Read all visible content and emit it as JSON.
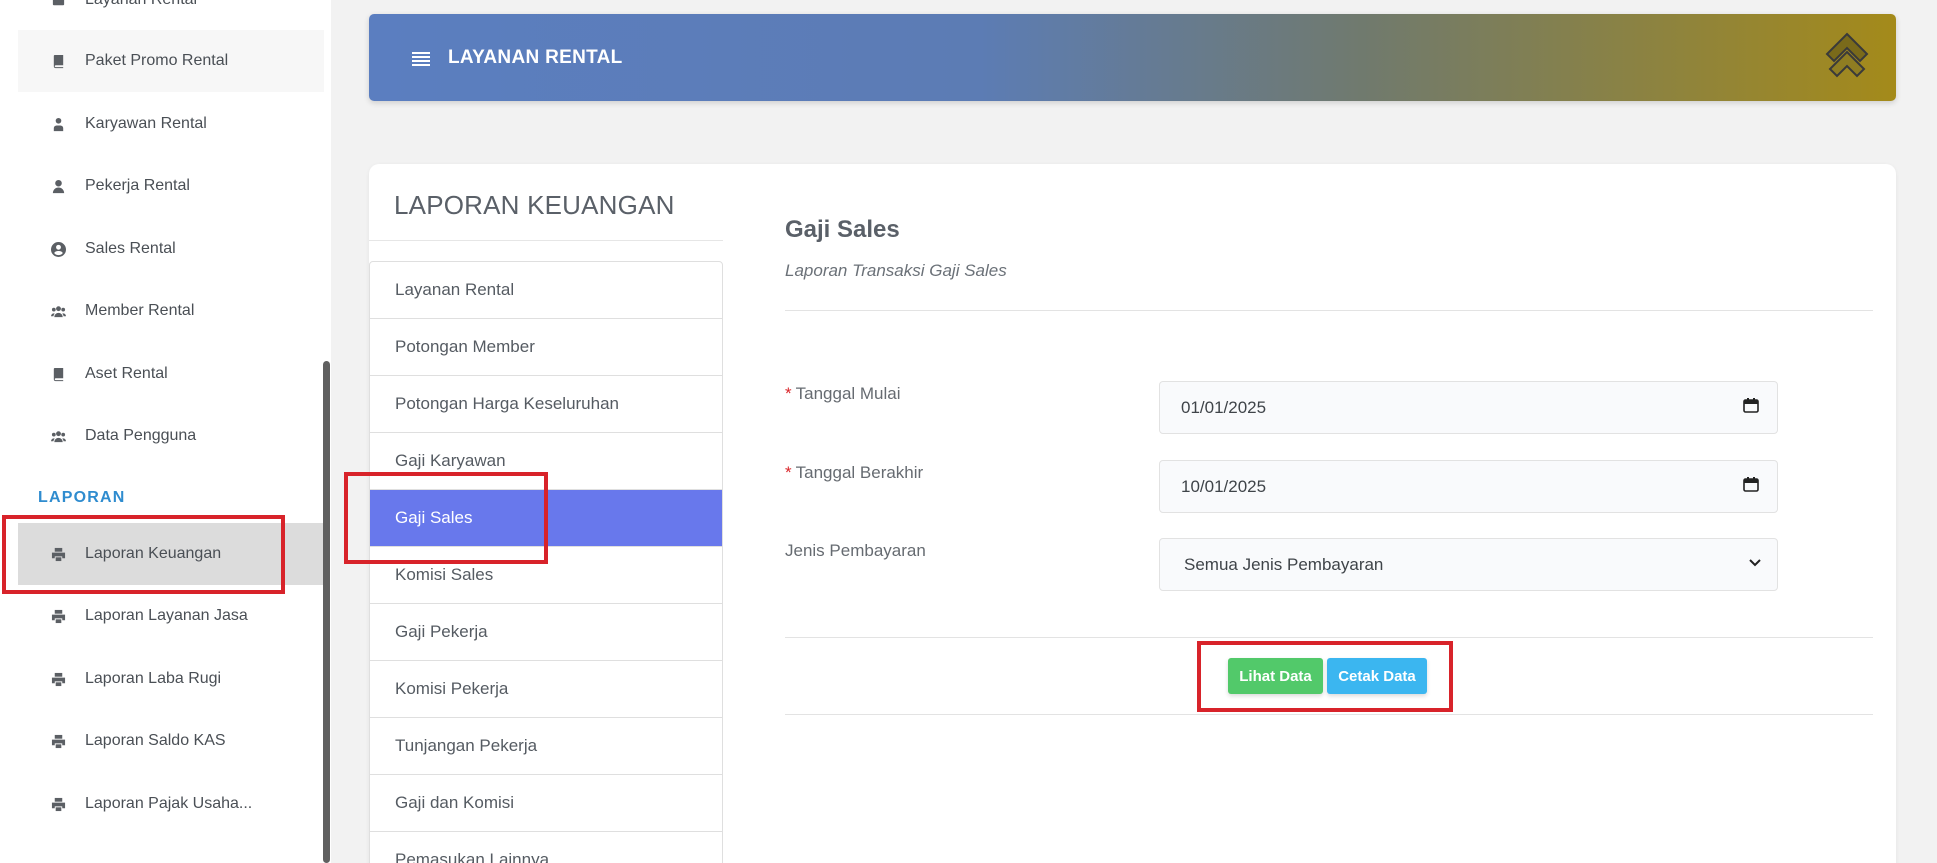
{
  "sidebar": {
    "items": [
      {
        "label": "Layanan Rental",
        "icon": "box-icon"
      },
      {
        "label": "Paket Promo Rental",
        "icon": "book-icon"
      },
      {
        "label": "Karyawan Rental",
        "icon": "user-tie-icon"
      },
      {
        "label": "Pekerja Rental",
        "icon": "user-icon"
      },
      {
        "label": "Sales Rental",
        "icon": "user-circle-icon"
      },
      {
        "label": "Member Rental",
        "icon": "users-icon"
      },
      {
        "label": "Aset Rental",
        "icon": "book-icon"
      },
      {
        "label": "Data Pengguna",
        "icon": "users-icon"
      }
    ],
    "section_label": "LAPORAN",
    "reports": [
      {
        "label": "Laporan Keuangan",
        "icon": "print-icon",
        "active": true
      },
      {
        "label": "Laporan Layanan Jasa",
        "icon": "print-icon"
      },
      {
        "label": "Laporan Laba Rugi",
        "icon": "print-icon"
      },
      {
        "label": "Laporan Saldo KAS",
        "icon": "print-icon"
      },
      {
        "label": "Laporan Pajak Usaha...",
        "icon": "print-icon"
      }
    ]
  },
  "header": {
    "title": "LAYANAN RENTAL"
  },
  "left_panel": {
    "title": "LAPORAN KEUANGAN",
    "items": [
      "Layanan Rental",
      "Potongan Member",
      "Potongan Harga Keseluruhan",
      "Gaji Karyawan",
      "Gaji Sales",
      "Komisi Sales",
      "Gaji Pekerja",
      "Komisi Pekerja",
      "Tunjangan Pekerja",
      "Gaji dan Komisi",
      "Pemasukan Lainnya"
    ],
    "active_item": "Gaji Sales"
  },
  "content": {
    "title": "Gaji Sales",
    "subtitle": "Laporan Transaksi Gaji Sales",
    "form": {
      "start_label": "Tanggal Mulai",
      "start_value": "01/01/2025",
      "end_label": "Tanggal Berakhir",
      "end_value": "10/01/2025",
      "payment_label": "Jenis Pembayaran",
      "payment_value": "Semua Jenis Pembayaran",
      "required_mark": "*"
    },
    "buttons": {
      "view": "Lihat Data",
      "print": "Cetak Data"
    }
  },
  "colors": {
    "accent_active": "#6878ec",
    "section_blue": "#2f8ccf",
    "button_green": "#52c96a",
    "button_blue": "#3bb6f0",
    "annotation_red": "#d8232a"
  }
}
